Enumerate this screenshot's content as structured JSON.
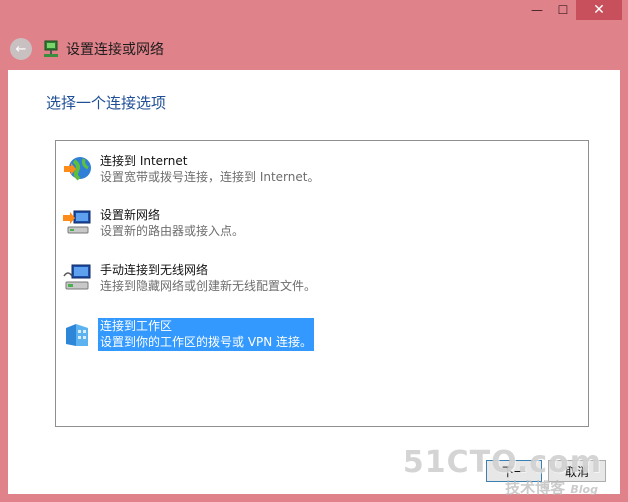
{
  "window": {
    "caption": {
      "minimize": "—",
      "maximize": "☐",
      "close": "✕"
    }
  },
  "header": {
    "back_glyph": "←",
    "title": "设置连接或网络"
  },
  "instruction": "选择一个连接选项",
  "options": [
    {
      "title": "连接到 Internet",
      "description": "设置宽带或拨号连接，连接到 Internet。",
      "icon": "globe-network-icon"
    },
    {
      "title": "设置新网络",
      "description": "设置新的路由器或接入点。",
      "icon": "router-setup-icon"
    },
    {
      "title": "手动连接到无线网络",
      "description": "连接到隐藏网络或创建新无线配置文件。",
      "icon": "wireless-network-icon"
    },
    {
      "title": "连接到工作区",
      "description": "设置到你的工作区的拨号或 VPN 连接。",
      "icon": "workplace-icon",
      "selected": true
    }
  ],
  "buttons": {
    "next": "下一",
    "cancel": "取消"
  },
  "watermark": {
    "main": "51CTO.com",
    "sub": "技术博客",
    "blog": "Blog"
  },
  "colors": {
    "frame": "#e0828a",
    "instruction": "#1f4f96",
    "selection": "#3399ff"
  }
}
